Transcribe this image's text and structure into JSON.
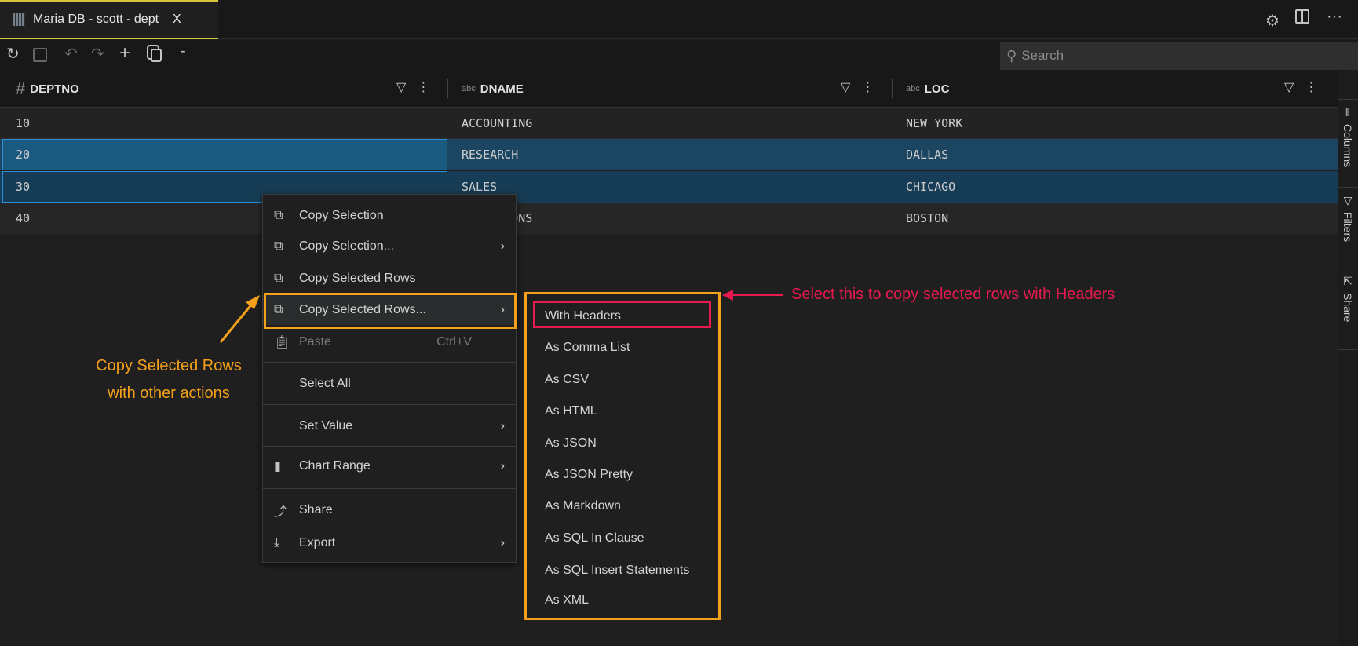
{
  "tab": {
    "title": "Maria DB - scott - dept",
    "close": "X",
    "icon": "table-icon"
  },
  "window_icons": [
    "gear-icon",
    "split-editor-icon",
    "more-icon"
  ],
  "toolbar": {
    "buttons": [
      "refresh-icon",
      "save-icon",
      "undo-icon",
      "redo-icon",
      "add-row-icon",
      "copy-icon",
      "remove-row-icon"
    ],
    "add": "+",
    "remove": "-",
    "search_placeholder": "Search"
  },
  "columns": [
    {
      "name": "DEPTNO",
      "type": "#"
    },
    {
      "name": "DNAME",
      "type": "abc"
    },
    {
      "name": "LOC",
      "type": "abc"
    }
  ],
  "rows": [
    [
      "10",
      "ACCOUNTING",
      "NEW YORK"
    ],
    [
      "20",
      "RESEARCH",
      "DALLAS"
    ],
    [
      "30",
      "SALES",
      "CHICAGO"
    ],
    [
      "40",
      "OPERATIONS",
      "BOSTON"
    ]
  ],
  "selected_rows": [
    "20",
    "30"
  ],
  "sidebar": {
    "columns": "Columns",
    "filters": "Filters",
    "share": "Share"
  },
  "menu": {
    "items": [
      {
        "label": "Copy Selection",
        "icon": "copy-icon"
      },
      {
        "label": "Copy Selection...",
        "icon": "copy-icon",
        "submenu": true
      },
      {
        "label": "Copy Selected Rows",
        "icon": "copy-icon"
      },
      {
        "label": "Copy Selected Rows...",
        "icon": "copy-icon",
        "submenu": true
      },
      {
        "label": "Paste",
        "icon": "clipboard-icon",
        "shortcut": "Ctrl+V",
        "disabled": true
      },
      {
        "label": "Select All"
      },
      {
        "label": "Set Value",
        "submenu": true
      },
      {
        "label": "Chart Range",
        "icon": "bar-chart-icon",
        "submenu": true
      },
      {
        "label": "Share",
        "icon": "share-icon"
      },
      {
        "label": "Export",
        "icon": "download-icon",
        "submenu": true
      }
    ]
  },
  "submenu": [
    "With Headers",
    "As Comma List",
    "As CSV",
    "As HTML",
    "As JSON",
    "As JSON Pretty",
    "As Markdown",
    "As SQL In Clause",
    "As SQL Insert Statements",
    "As XML"
  ],
  "annotations": {
    "left_line1": "Copy Selected Rows",
    "left_line2": "with other actions",
    "right": "Select this to copy selected rows with Headers",
    "colors": {
      "orange": "#f5a01a",
      "red": "#e8194f"
    }
  }
}
